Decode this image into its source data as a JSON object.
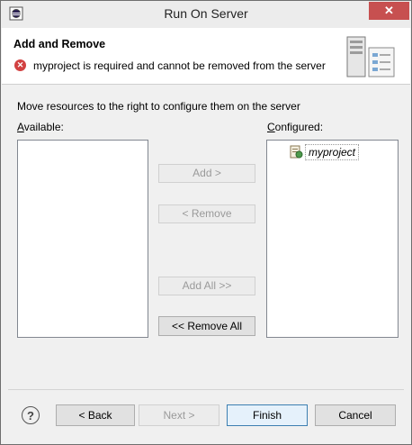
{
  "window": {
    "title": "Run On Server",
    "close_label": "✕"
  },
  "header": {
    "title": "Add and Remove",
    "error_message": "myproject is required and cannot be removed from the server"
  },
  "body": {
    "instruction": "Move resources to the right to configure them on the server",
    "available_label": "Available:",
    "configured_label": "Configured:",
    "available_items": [],
    "configured_items": [
      {
        "label": "myproject"
      }
    ]
  },
  "buttons": {
    "add": "Add >",
    "remove": "< Remove",
    "add_all": "Add All >>",
    "remove_all": "<< Remove All"
  },
  "footer": {
    "help": "?",
    "back": "< Back",
    "next": "Next >",
    "finish": "Finish",
    "cancel": "Cancel"
  }
}
